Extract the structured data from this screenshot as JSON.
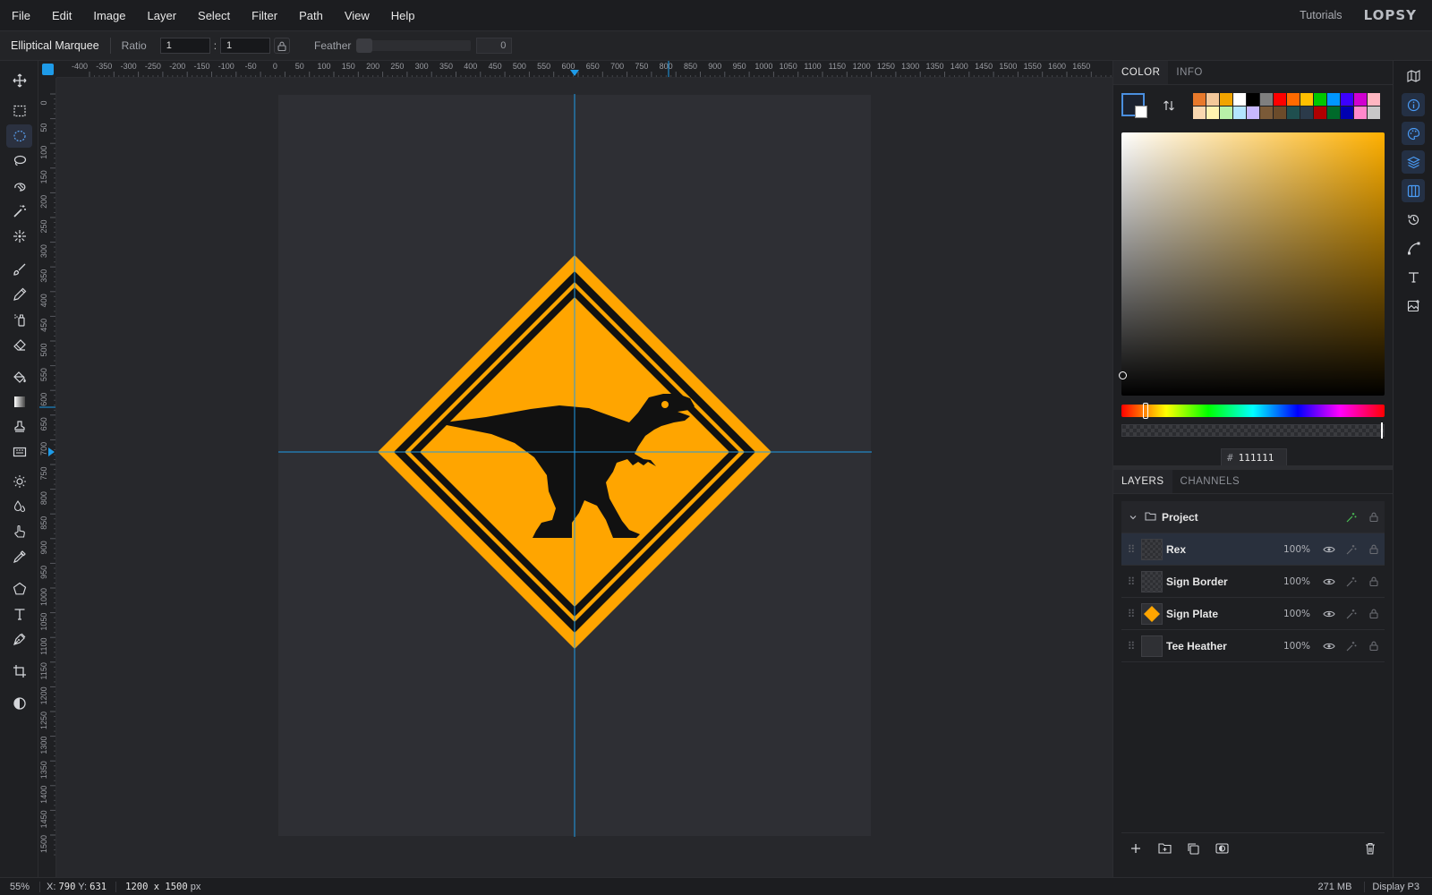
{
  "menu": {
    "items": [
      "File",
      "Edit",
      "Image",
      "Layer",
      "Select",
      "Filter",
      "Path",
      "View",
      "Help"
    ],
    "tutorials": "Tutorials",
    "logo": "LOPSY"
  },
  "options": {
    "tool_name": "Elliptical Marquee",
    "ratio_label": "Ratio",
    "ratio_w": "1",
    "ratio_sep": ":",
    "ratio_h": "1",
    "feather_label": "Feather",
    "feather_value": "0"
  },
  "toolbar": {
    "active_tool": "elliptical-marquee",
    "tools": [
      "move",
      "rectangular-marquee",
      "elliptical-marquee",
      "lasso",
      "magnetic-lasso",
      "magic-wand",
      "quick-select",
      "brush",
      "pencil",
      "spray",
      "eraser",
      "paint-bucket",
      "gradient",
      "clone-stamp",
      "pattern",
      "dodge",
      "blur",
      "smudge",
      "eyedropper",
      "shape",
      "text",
      "pen",
      "crop",
      "foreground-background"
    ]
  },
  "rulers": {
    "top_labels": [
      "-400",
      "-350",
      "-300",
      "-250",
      "-200",
      "-150",
      "-100",
      "-50",
      "0",
      "50",
      "100",
      "150",
      "200",
      "250",
      "300",
      "350",
      "400",
      "450",
      "500",
      "550",
      "600",
      "650",
      "700",
      "750",
      "800",
      "850",
      "900",
      "950",
      "1000",
      "1050",
      "1100",
      "1150",
      "1200",
      "1250",
      "1300",
      "1350",
      "1400",
      "1450",
      "1500",
      "1550",
      "1600",
      "1650"
    ],
    "left_labels": [
      "0",
      "50",
      "100",
      "150",
      "200",
      "250",
      "300",
      "350",
      "400",
      "450",
      "500",
      "550",
      "600",
      "650",
      "700",
      "750",
      "800",
      "850",
      "900",
      "950",
      "1000",
      "1050",
      "1100",
      "1150",
      "1200",
      "1250",
      "1300",
      "1350",
      "1400",
      "1450",
      "1500"
    ]
  },
  "canvas": {
    "background": "#27282c",
    "document_color": "#2e2f34",
    "sign_color": "#ffa500",
    "ink_color": "#111111",
    "guide_color": "#1e9be8"
  },
  "color_panel": {
    "tabs": [
      "COLOR",
      "INFO"
    ],
    "active_tab": "COLOR",
    "foreground": "#111111",
    "background": "#ffffff",
    "palette": [
      "#e8792b",
      "#f3c89a",
      "#f1a400",
      "#ffffff",
      "#000000",
      "#7f7f7f",
      "#ff0000",
      "#ff6a00",
      "#ffbf00",
      "#00c800",
      "#0096ff",
      "#3c00ff",
      "#d000d0",
      "#ffb6c1",
      "#f9d8b0",
      "#fff3b0",
      "#b8f0a8",
      "#b3e5ff",
      "#c7b8ff",
      "#7a5a38",
      "#6b4b2a",
      "#1f4f4f",
      "#2b3a4a",
      "#b00000",
      "#006a2a",
      "#0000b0",
      "#ff88cc",
      "#c8c8c8"
    ],
    "hue_color": "#ffb000",
    "hex_label": "#",
    "hex_value": "111111"
  },
  "layers_panel": {
    "tabs": [
      "LAYERS",
      "CHANNELS"
    ],
    "active_tab": "LAYERS",
    "group": {
      "name": "Project"
    },
    "layers": [
      {
        "name": "Rex",
        "opacity": "100%",
        "selected": true,
        "thumb": "checker"
      },
      {
        "name": "Sign Border",
        "opacity": "100%",
        "selected": false,
        "thumb": "checker"
      },
      {
        "name": "Sign Plate",
        "opacity": "100%",
        "selected": false,
        "thumb": "diamond"
      },
      {
        "name": "Tee Heather",
        "opacity": "100%",
        "selected": false,
        "thumb": "plain"
      }
    ]
  },
  "status": {
    "zoom": "55%",
    "coord_x_label": "X:",
    "coord_x": "790",
    "coord_y_label": "Y:",
    "coord_y": "631",
    "doc_size": "1200 x 1500",
    "doc_unit": "px",
    "memory": "271 MB",
    "color_profile": "Display P3"
  }
}
